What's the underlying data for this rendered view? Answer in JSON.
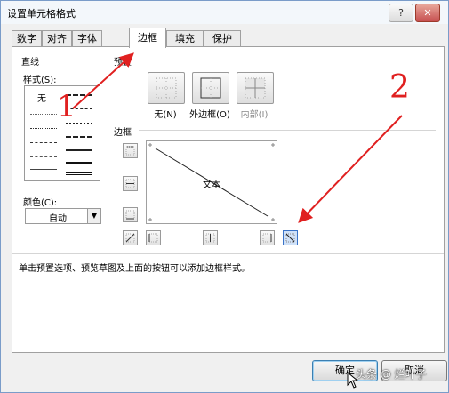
{
  "window": {
    "title": "设置单元格格式",
    "help_icon": "?",
    "close_icon": "✕"
  },
  "tabs": [
    {
      "label": "数字"
    },
    {
      "label": "对齐"
    },
    {
      "label": "字体"
    },
    {
      "label": "边框"
    },
    {
      "label": "填充"
    },
    {
      "label": "保护"
    }
  ],
  "active_tab": "边框",
  "line": {
    "group_title": "直线",
    "style_label": "样式(S):",
    "none_label": "无",
    "color_label": "颜色(C):",
    "color_value": "自动"
  },
  "presets": {
    "group_title": "预置",
    "none_label": "无(N)",
    "outline_label": "外边框(O)",
    "inside_label": "内部(I)"
  },
  "border": {
    "group_title": "边框",
    "preview_text": "文本",
    "diagonal_down_selected": true
  },
  "hint": "单击预置选项、预览草图及上面的按钮可以添加边框样式。",
  "buttons": {
    "ok": "确定",
    "cancel": "取消"
  },
  "annotations": {
    "one": "1",
    "two": "2"
  },
  "watermark": "头条 @ 烂叶子",
  "colors": {
    "arrow": "#e02020",
    "selected_border": "#3a73c8"
  }
}
